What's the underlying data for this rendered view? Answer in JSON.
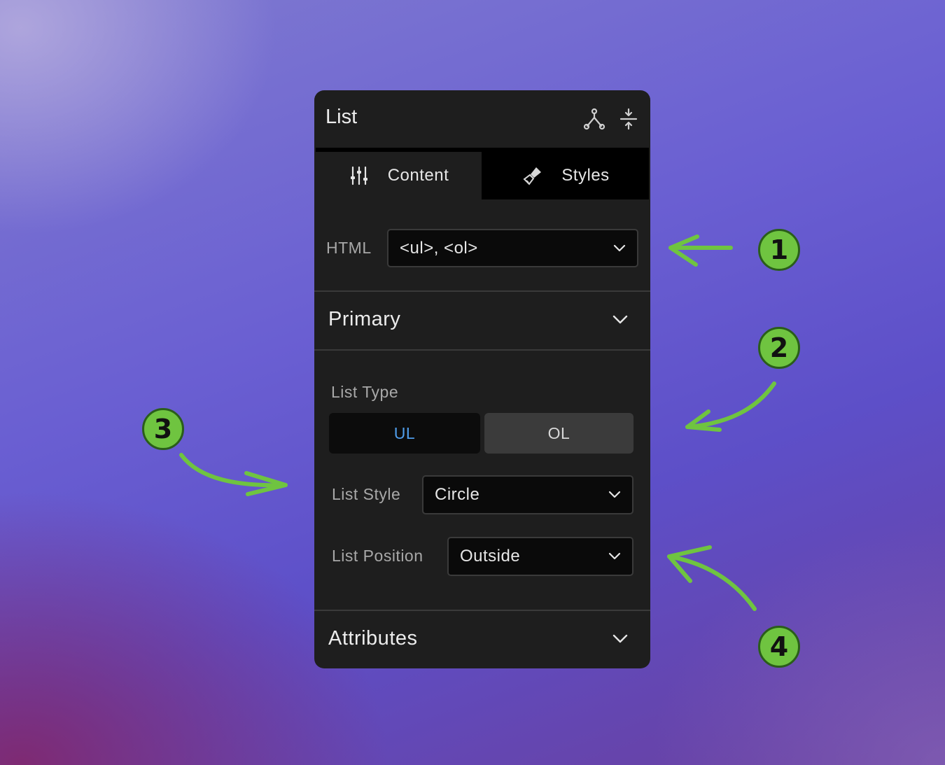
{
  "panel": {
    "title": "List",
    "header_icons": [
      "hierarchy-icon",
      "expand-collapse-icon"
    ],
    "tabs": [
      {
        "label": "Content",
        "icon": "sliders-icon",
        "active": true
      },
      {
        "label": "Styles",
        "icon": "paintbrush-icon",
        "active": false
      }
    ],
    "html_field": {
      "label": "HTML",
      "value": "<ul>, <ol>"
    },
    "sections": {
      "primary": {
        "title": "Primary"
      },
      "attributes": {
        "title": "Attributes"
      }
    },
    "list_type": {
      "label": "List Type",
      "options": [
        {
          "label": "UL",
          "selected": true
        },
        {
          "label": "OL",
          "selected": false
        }
      ]
    },
    "list_style": {
      "label": "List Style",
      "value": "Circle"
    },
    "list_position": {
      "label": "List Position",
      "value": "Outside"
    }
  },
  "annotations": {
    "badges": [
      "1",
      "2",
      "3",
      "4"
    ],
    "color": "#6fc440"
  },
  "colors": {
    "accent_selected": "#4f9dea",
    "panel_bg": "#1e1e1e",
    "annotation_green": "#6fc440"
  }
}
